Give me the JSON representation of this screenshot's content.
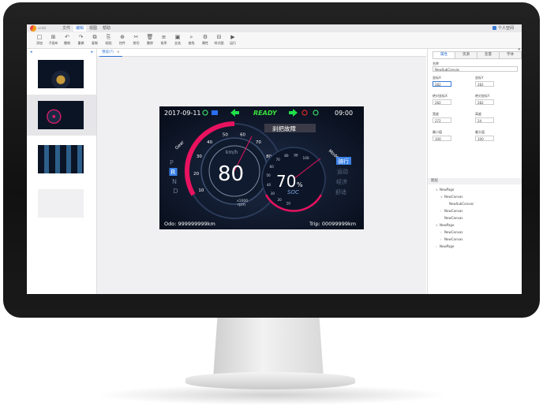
{
  "app": {
    "logo_text": "ui-kit"
  },
  "menu": [
    {
      "label": "文件",
      "active": false
    },
    {
      "label": "编辑",
      "active": true
    },
    {
      "label": "视图",
      "active": false
    },
    {
      "label": "帮助",
      "active": false
    }
  ],
  "user": {
    "label": "个人空间"
  },
  "toolbar": [
    {
      "label": "添加",
      "icon": "□"
    },
    {
      "label": "子画布",
      "icon": "⊞"
    },
    {
      "label": "撤销",
      "icon": "↶"
    },
    {
      "label": "重做",
      "icon": "↷"
    },
    {
      "label": "复制",
      "icon": "⧉"
    },
    {
      "label": "粘贴",
      "icon": "⎘"
    },
    {
      "label": "控件",
      "icon": "⊕"
    },
    {
      "label": "剪切",
      "icon": "✂"
    },
    {
      "label": "删除",
      "icon": "🗑"
    },
    {
      "label": "排序",
      "icon": "≡"
    },
    {
      "label": "全选",
      "icon": "▣"
    },
    {
      "label": "查找",
      "icon": "⌕"
    },
    {
      "label": "属性",
      "icon": "⚙"
    },
    {
      "label": "样式图",
      "icon": "⊟"
    },
    {
      "label": "运行",
      "icon": "▶"
    }
  ],
  "editor_tab": {
    "label": "预览(?)"
  },
  "dashboard": {
    "date": "2017-09-11",
    "ready": "READY",
    "time": "09:00",
    "fault": "刹把故障",
    "speed": "80",
    "speed_unit": "km/h",
    "rpm_unit": "x1000\nrpm",
    "soc_value": "70",
    "soc_pct": "%",
    "soc_label": "SOC",
    "gear_label": "Gear",
    "mode_label": "Mode",
    "gears": [
      "P",
      "R",
      "N",
      "D"
    ],
    "active_gear": "R",
    "modes": [
      "骑行",
      "运动",
      "经济",
      "舒适"
    ],
    "odo": "Odo: 999999999km",
    "trip": "Trip: 00099999km",
    "speed_ticks": [
      "10",
      "20",
      "30",
      "40",
      "50",
      "60",
      "70",
      "80",
      "90",
      "100"
    ],
    "soc_ticks": [
      "50",
      "60",
      "70",
      "80",
      "90",
      "100"
    ],
    "soc_ticks2": [
      "100",
      "90",
      "80",
      "70",
      "60",
      "50",
      "40",
      "30",
      "20",
      "10"
    ]
  },
  "right_panel": {
    "tabs": [
      "属性",
      "资源",
      "变量",
      "字体"
    ],
    "active_tab": "属性",
    "name_label": "名称",
    "name_value": "NewSubCanvas",
    "fields": [
      {
        "label": "坐标X",
        "value": "282",
        "hl": true
      },
      {
        "label": "坐标Y",
        "value": "282",
        "hl": false
      },
      {
        "label": "绝对坐标X",
        "value": "282",
        "hl": false
      },
      {
        "label": "绝对坐标Y",
        "value": "282",
        "hl": false
      },
      {
        "label": "宽度",
        "value": "372",
        "hl": false
      },
      {
        "label": "高度",
        "value": "24",
        "hl": false
      },
      {
        "label": "最小值",
        "value": "100",
        "hl": false
      },
      {
        "label": "最大值",
        "value": "100",
        "hl": false
      }
    ],
    "layers_label": "图层",
    "tree": [
      {
        "label": "NewPage",
        "indent": 1,
        "arrow": "∨"
      },
      {
        "label": "NewCanvas",
        "indent": 2,
        "arrow": "∨"
      },
      {
        "label": "NewSubCanvas",
        "indent": 3,
        "arrow": ""
      },
      {
        "label": "NewCanvas",
        "indent": 2,
        "arrow": "›"
      },
      {
        "label": "NewCanvas",
        "indent": 2,
        "arrow": ""
      },
      {
        "label": "NewPage",
        "indent": 1,
        "arrow": "∨"
      },
      {
        "label": "NewCanvas",
        "indent": 2,
        "arrow": "›"
      },
      {
        "label": "NewCanvas",
        "indent": 2,
        "arrow": "›"
      },
      {
        "label": "NewPage",
        "indent": 1,
        "arrow": "›"
      }
    ]
  }
}
